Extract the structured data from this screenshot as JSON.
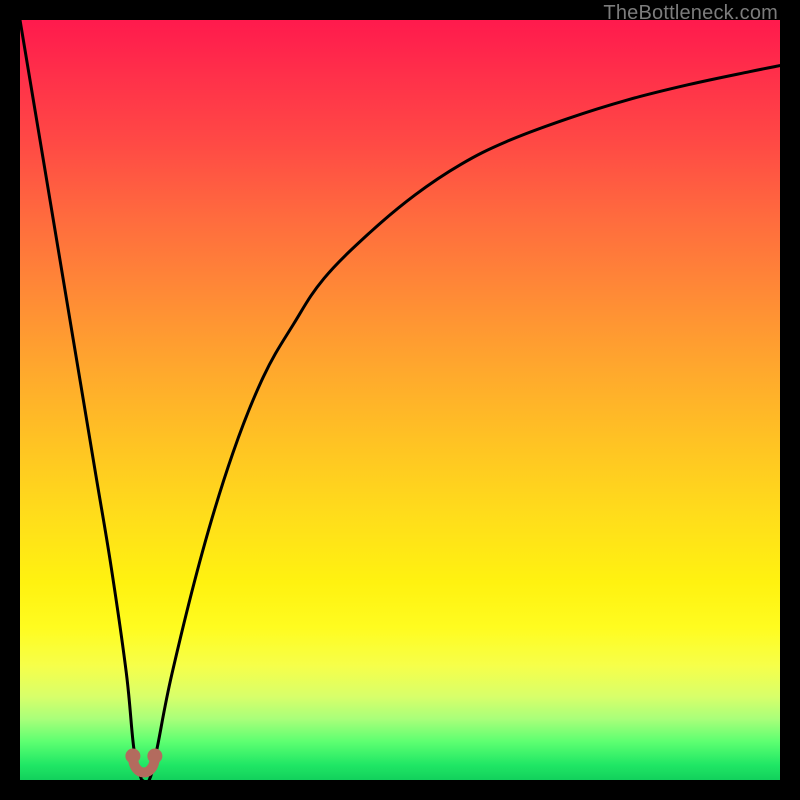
{
  "watermark": "TheBottleneck.com",
  "chart_data": {
    "type": "line",
    "title": "",
    "xlabel": "",
    "ylabel": "",
    "xlim": [
      0,
      100
    ],
    "ylim": [
      0,
      100
    ],
    "grid": false,
    "legend": false,
    "background_gradient": {
      "direction": "vertical",
      "stops": [
        {
          "pos": 0,
          "color": "#ff1a4d",
          "meaning": "high_bottleneck"
        },
        {
          "pos": 50,
          "color": "#ffb028",
          "meaning": "moderate"
        },
        {
          "pos": 80,
          "color": "#fff210",
          "meaning": "low"
        },
        {
          "pos": 98,
          "color": "#20e765",
          "meaning": "optimal"
        }
      ]
    },
    "series": [
      {
        "name": "bottleneck_percent",
        "x": [
          0,
          2,
          4,
          6,
          8,
          10,
          12,
          14,
          15,
          16,
          17,
          18,
          20,
          24,
          28,
          32,
          36,
          40,
          46,
          52,
          58,
          64,
          72,
          80,
          88,
          96,
          100
        ],
        "values": [
          100,
          88,
          76,
          64,
          52,
          40,
          28,
          14,
          4,
          0,
          0,
          4,
          14,
          30,
          43,
          53,
          60,
          66,
          72,
          77,
          81,
          84,
          87,
          89.5,
          91.5,
          93.2,
          94
        ]
      }
    ],
    "marker": {
      "name": "optimal_point",
      "x": 16.3,
      "y_marker_center": 1.5,
      "shape": "double_dot_u",
      "color": "#b36b5e"
    }
  }
}
